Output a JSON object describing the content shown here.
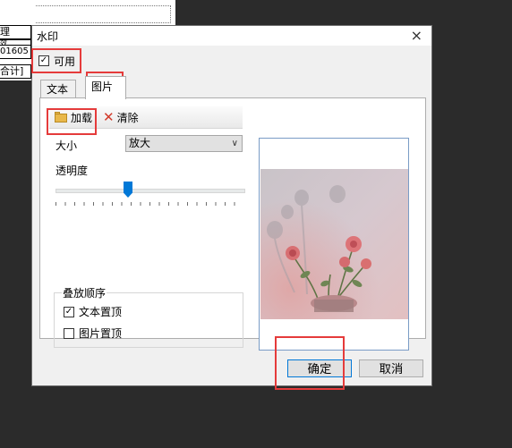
{
  "background": {
    "cells": [
      "理",
      "效",
      "01605",
      "合计]"
    ]
  },
  "dialog": {
    "title": "水印",
    "close_glyph": "×",
    "enable_label": "可用",
    "enable_checked": "✓",
    "tabs": [
      {
        "label": "文本"
      },
      {
        "label": "图片"
      }
    ],
    "toolbar": {
      "load_label": "加载",
      "clear_label": "清除"
    },
    "size_label": "大小",
    "size_value": "放大",
    "opacity_label": "透明度",
    "opacity_fraction": 0.38,
    "stack_order_title": "叠放顺序",
    "options": [
      {
        "label": "文本置顶",
        "checked": "✓"
      },
      {
        "label": "图片置顶",
        "checked": ""
      }
    ],
    "ok_label": "确定",
    "cancel_label": "取消"
  },
  "colors": {
    "accent": "#0078d7",
    "highlight": "#e53b3b"
  }
}
